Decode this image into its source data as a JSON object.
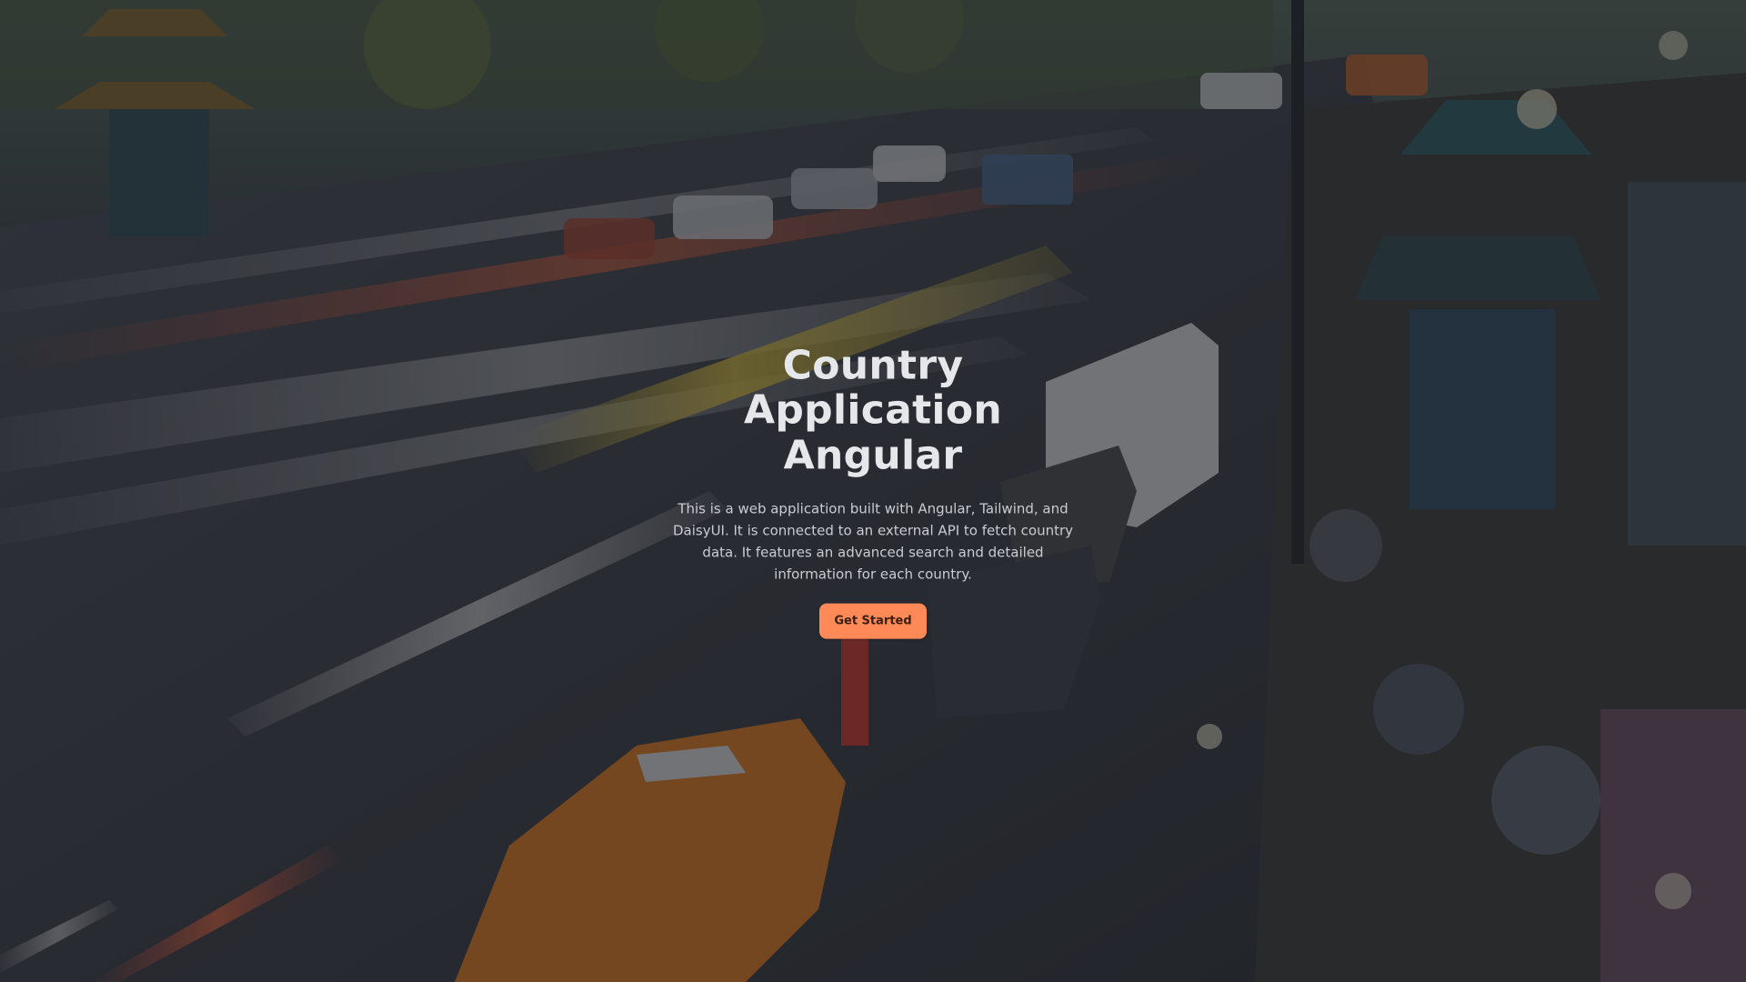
{
  "hero": {
    "title_lines": [
      "Country",
      "Application",
      "Angular"
    ],
    "description": "This is a web application built with Angular, Tailwind, and DaisyUI. It is connected to an external API to fetch country data. It features an advanced search and detailed information for each country.",
    "cta_label": "Get Started",
    "background_image": "night-street-traffic-photo"
  },
  "colors": {
    "accent": "#ff8a57",
    "overlay": "#1c1f25",
    "title": "#e6e7ea",
    "text": "#c9ccd3"
  }
}
